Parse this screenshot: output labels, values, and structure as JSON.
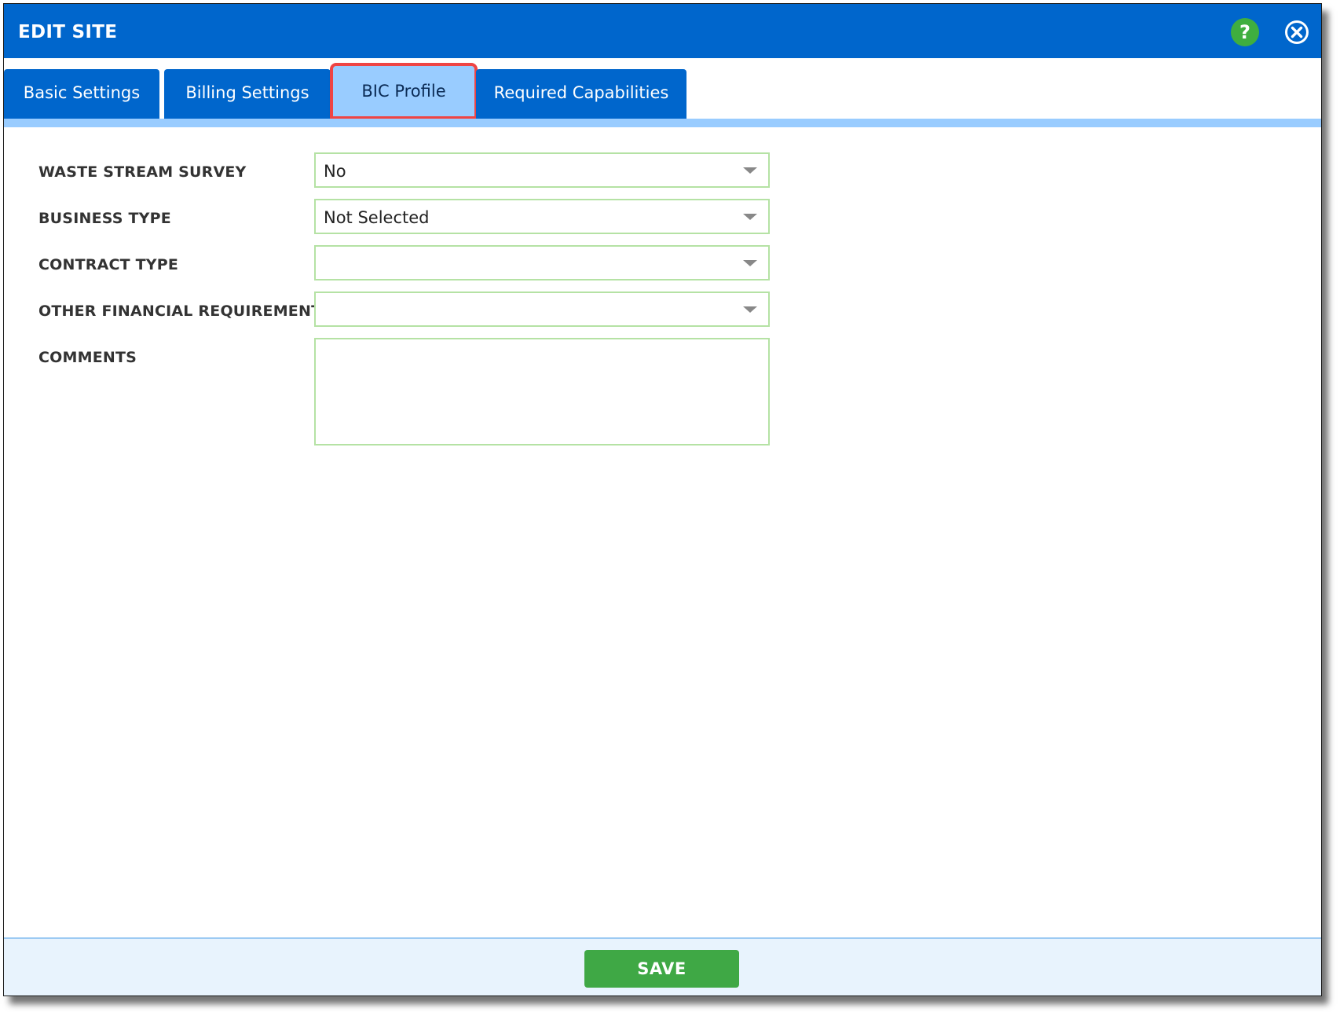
{
  "window": {
    "title": "EDIT SITE",
    "help_label": "?",
    "close_icon": "close-circle-icon"
  },
  "tabs": [
    {
      "label": "Basic Settings",
      "active": false
    },
    {
      "label": "Billing Settings",
      "active": false
    },
    {
      "label": "BIC Profile",
      "active": true
    },
    {
      "label": "Required Capabilities",
      "active": false
    }
  ],
  "form": {
    "waste_stream_survey": {
      "label": "WASTE STREAM SURVEY",
      "value": "No"
    },
    "business_type": {
      "label": "BUSINESS TYPE",
      "value": "Not Selected"
    },
    "contract_type": {
      "label": "CONTRACT TYPE",
      "value": ""
    },
    "other_financial_requirements": {
      "label": "OTHER FINANCIAL REQUIREMENTS",
      "value": ""
    },
    "comments": {
      "label": "COMMENTS",
      "value": ""
    }
  },
  "footer": {
    "save_label": "SAVE"
  },
  "colors": {
    "header_blue": "#0066cc",
    "active_tab": "#99ccff",
    "highlight_red": "#ef4444",
    "field_border": "#b5e2a4",
    "save_green": "#3fa845",
    "help_green": "#3fae3f",
    "footer_bg": "#e8f3fd"
  }
}
